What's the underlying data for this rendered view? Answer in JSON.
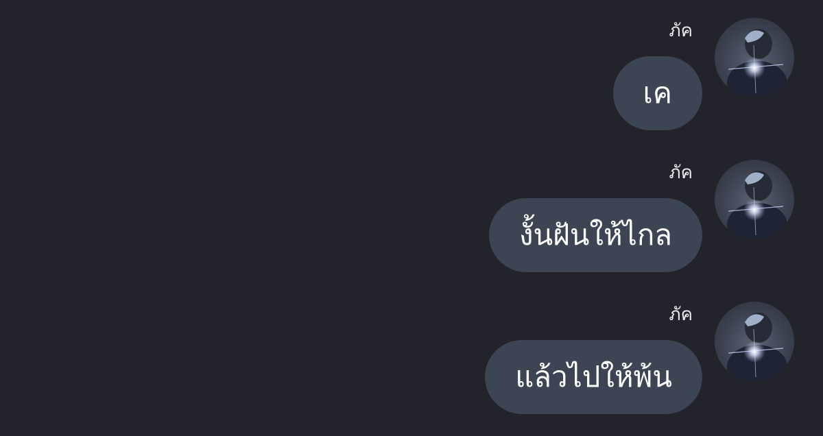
{
  "messages": [
    {
      "sender": "ภัค",
      "text": "เค"
    },
    {
      "sender": "ภัค",
      "text": "งั้นฝันให้ไกล"
    },
    {
      "sender": "ภัค",
      "text": "แล้วไปให้พ้น"
    }
  ],
  "theme": {
    "background": "#23242b",
    "bubble": "#3d4454",
    "text": "#ffffff"
  }
}
